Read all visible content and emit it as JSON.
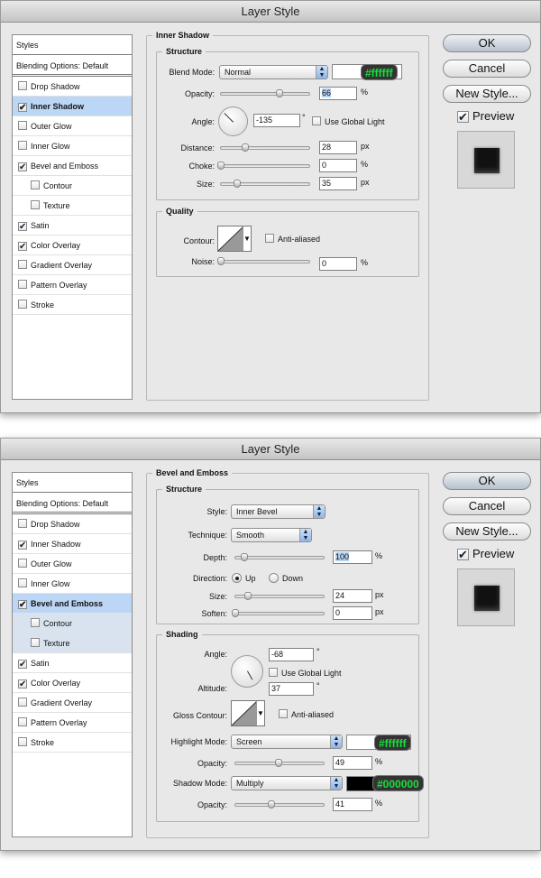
{
  "dialog1": {
    "title": "Layer Style",
    "styles_header": "Styles",
    "blending": "Blending Options: Default",
    "items": [
      {
        "label": "Drop Shadow",
        "checked": false
      },
      {
        "label": "Inner Shadow",
        "checked": true
      },
      {
        "label": "Outer Glow",
        "checked": false
      },
      {
        "label": "Inner Glow",
        "checked": false
      },
      {
        "label": "Bevel and Emboss",
        "checked": true
      },
      {
        "label": "Contour",
        "checked": false
      },
      {
        "label": "Texture",
        "checked": false
      },
      {
        "label": "Satin",
        "checked": true
      },
      {
        "label": "Color Overlay",
        "checked": true
      },
      {
        "label": "Gradient Overlay",
        "checked": false
      },
      {
        "label": "Pattern Overlay",
        "checked": false
      },
      {
        "label": "Stroke",
        "checked": false
      }
    ],
    "section_title": "Inner Shadow",
    "structure": {
      "title": "Structure",
      "blend_mode_label": "Blend Mode:",
      "blend_mode_value": "Normal",
      "color_hex": "#ffffff",
      "opacity_label": "Opacity:",
      "opacity_value": "66",
      "opacity_unit": "%",
      "angle_label": "Angle:",
      "angle_value": "-135",
      "degree_symbol": "°",
      "global_light": "Use Global Light",
      "distance_label": "Distance:",
      "distance_value": "28",
      "distance_unit": "px",
      "choke_label": "Choke:",
      "choke_value": "0",
      "choke_unit": "%",
      "size_label": "Size:",
      "size_value": "35",
      "size_unit": "px"
    },
    "quality": {
      "title": "Quality",
      "contour_label": "Contour:",
      "anti_aliased": "Anti-aliased",
      "noise_label": "Noise:",
      "noise_value": "0",
      "noise_unit": "%"
    }
  },
  "dialog2": {
    "title": "Layer Style",
    "styles_header": "Styles",
    "blending": "Blending Options: Default",
    "items": [
      {
        "label": "Drop Shadow",
        "checked": false
      },
      {
        "label": "Inner Shadow",
        "checked": true
      },
      {
        "label": "Outer Glow",
        "checked": false
      },
      {
        "label": "Inner Glow",
        "checked": false
      },
      {
        "label": "Bevel and Emboss",
        "checked": true
      },
      {
        "label": "Contour",
        "checked": false
      },
      {
        "label": "Texture",
        "checked": false
      },
      {
        "label": "Satin",
        "checked": true
      },
      {
        "label": "Color Overlay",
        "checked": true
      },
      {
        "label": "Gradient Overlay",
        "checked": false
      },
      {
        "label": "Pattern Overlay",
        "checked": false
      },
      {
        "label": "Stroke",
        "checked": false
      }
    ],
    "section_title": "Bevel and Emboss",
    "structure": {
      "title": "Structure",
      "style_label": "Style:",
      "style_value": "Inner Bevel",
      "technique_label": "Technique:",
      "technique_value": "Smooth",
      "depth_label": "Depth:",
      "depth_value": "100",
      "depth_unit": "%",
      "direction_label": "Direction:",
      "dir_up": "Up",
      "dir_down": "Down",
      "size_label": "Size:",
      "size_value": "24",
      "size_unit": "px",
      "soften_label": "Soften:",
      "soften_value": "0",
      "soften_unit": "px"
    },
    "shading": {
      "title": "Shading",
      "angle_label": "Angle:",
      "angle_value": "-68",
      "degree_symbol": "°",
      "global_light": "Use Global Light",
      "altitude_label": "Altitude:",
      "altitude_value": "37",
      "gloss_label": "Gloss Contour:",
      "anti_aliased": "Anti-aliased",
      "highlight_label": "Highlight Mode:",
      "highlight_value": "Screen",
      "highlight_hex": "#ffffff",
      "h_opacity_label": "Opacity:",
      "h_opacity_value": "49",
      "h_opacity_unit": "%",
      "shadow_label": "Shadow Mode:",
      "shadow_value": "Multiply",
      "shadow_hex": "#000000",
      "s_opacity_label": "Opacity:",
      "s_opacity_value": "41",
      "s_opacity_unit": "%"
    }
  },
  "buttons": {
    "ok": "OK",
    "cancel": "Cancel",
    "new_style": "New Style...",
    "preview": "Preview"
  },
  "checkmark": "✔"
}
